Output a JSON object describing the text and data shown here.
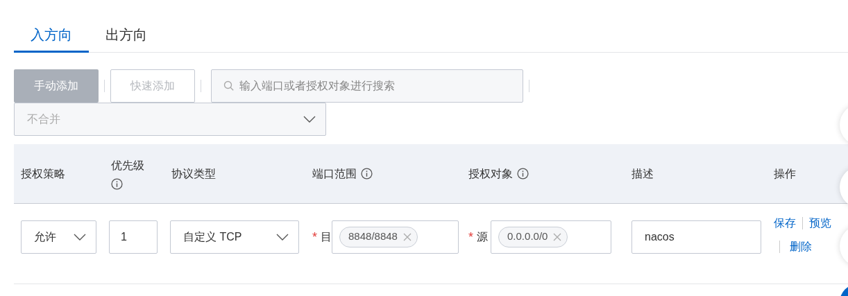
{
  "tabs": [
    {
      "label": "入方向",
      "selected": true
    },
    {
      "label": "出方向",
      "selected": false
    }
  ],
  "toolbar": {
    "buttons": [
      {
        "label": "手动添加",
        "kind": "filled",
        "disabled": true
      },
      {
        "label": "快速添加",
        "kind": "outline",
        "disabled": true
      }
    ],
    "search": {
      "placeholder": "输入端口或者授权对象进行搜索"
    },
    "merge_select": {
      "placeholder": "不合并"
    }
  },
  "table": {
    "columns": [
      {
        "label": "授权策略",
        "info": false
      },
      {
        "label": "优先级",
        "info": true
      },
      {
        "label": "协议类型",
        "info": false
      },
      {
        "label": "端口范围",
        "info": true
      },
      {
        "label": "授权对象",
        "info": true
      },
      {
        "label": "描述",
        "info": false
      },
      {
        "label": "操作",
        "info": false
      }
    ],
    "rows": [
      {
        "cells": [
          {
            "kind": "select",
            "value": "允许"
          },
          {
            "kind": "input",
            "value": "1"
          },
          {
            "kind": "select",
            "value": "自定义 TCP"
          },
          {
            "kind": "tags",
            "required_mark": "*",
            "label": "目",
            "tags": [
              "8848/8848"
            ]
          },
          {
            "kind": "tags",
            "required_mark": "*",
            "label": "源",
            "tags": [
              "0.0.0.0/0"
            ]
          },
          {
            "kind": "input",
            "value": "nacos"
          },
          {
            "kind": "actions",
            "actions": [
              "保存",
              "预览",
              "删除"
            ]
          }
        ]
      }
    ]
  }
}
